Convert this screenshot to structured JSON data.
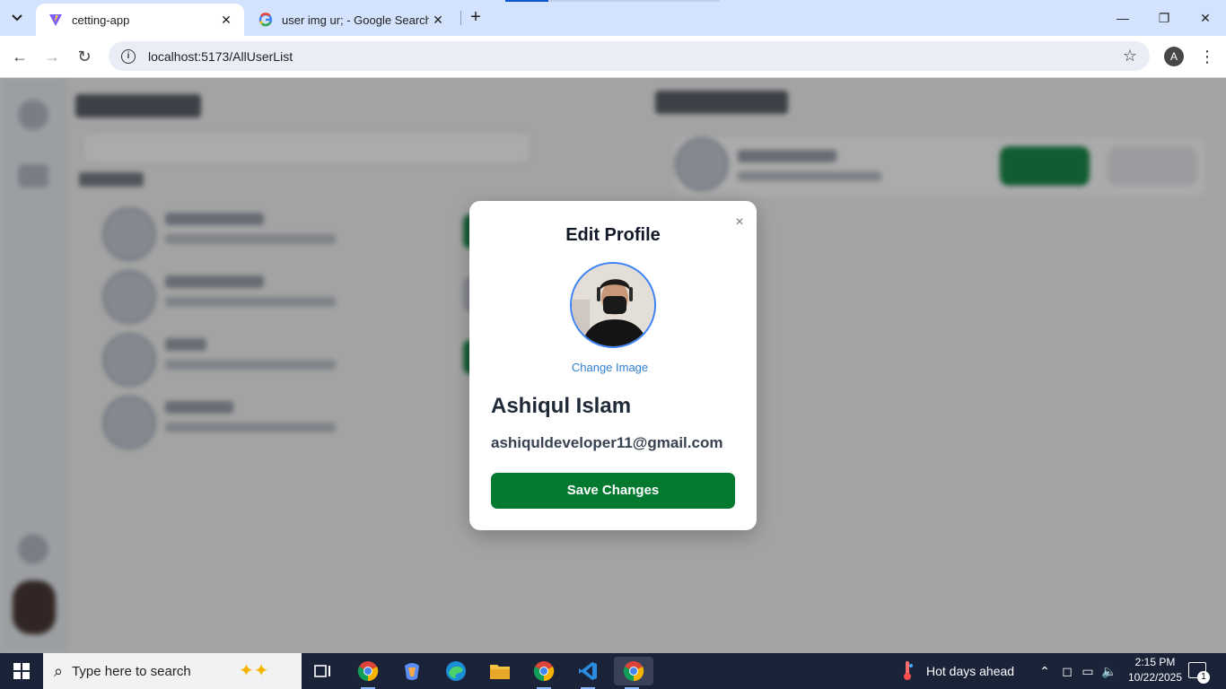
{
  "browser": {
    "tabs": [
      {
        "title": "cetting-app",
        "active": true
      },
      {
        "title": "user img ur; - Google Search",
        "active": false
      }
    ],
    "url": "localhost:5173/AllUserList",
    "profile_initial": "A"
  },
  "modal": {
    "title": "Edit Profile",
    "close_symbol": "×",
    "change_image_label": "Change Image",
    "user_name": "Ashiqul Islam",
    "user_email": "ashiquldeveloper11@gmail.com",
    "save_label": "Save Changes"
  },
  "taskbar": {
    "search_placeholder": "Type here to search",
    "weather": "Hot days ahead",
    "time": "2:15 PM",
    "date": "10/22/2025",
    "notification_count": "1"
  },
  "colors": {
    "accent_green": "#047a31",
    "link_blue": "#2f7fd1",
    "avatar_ring": "#3b82f6"
  },
  "icons": [
    "tab-search-icon",
    "vite-favicon-icon",
    "google-favicon-icon",
    "close-icon",
    "plus-icon",
    "minimize-icon",
    "restore-icon",
    "back-icon",
    "forward-icon",
    "reload-icon",
    "info-icon",
    "star-icon",
    "kebab-menu-icon",
    "windows-start-icon",
    "search-icon",
    "copilot-icon",
    "task-view-icon",
    "chrome-icon",
    "edge-icon",
    "folder-icon",
    "vscode-icon",
    "thermometer-icon",
    "chevron-up-icon",
    "network-icon",
    "volume-icon",
    "notification-icon"
  ]
}
